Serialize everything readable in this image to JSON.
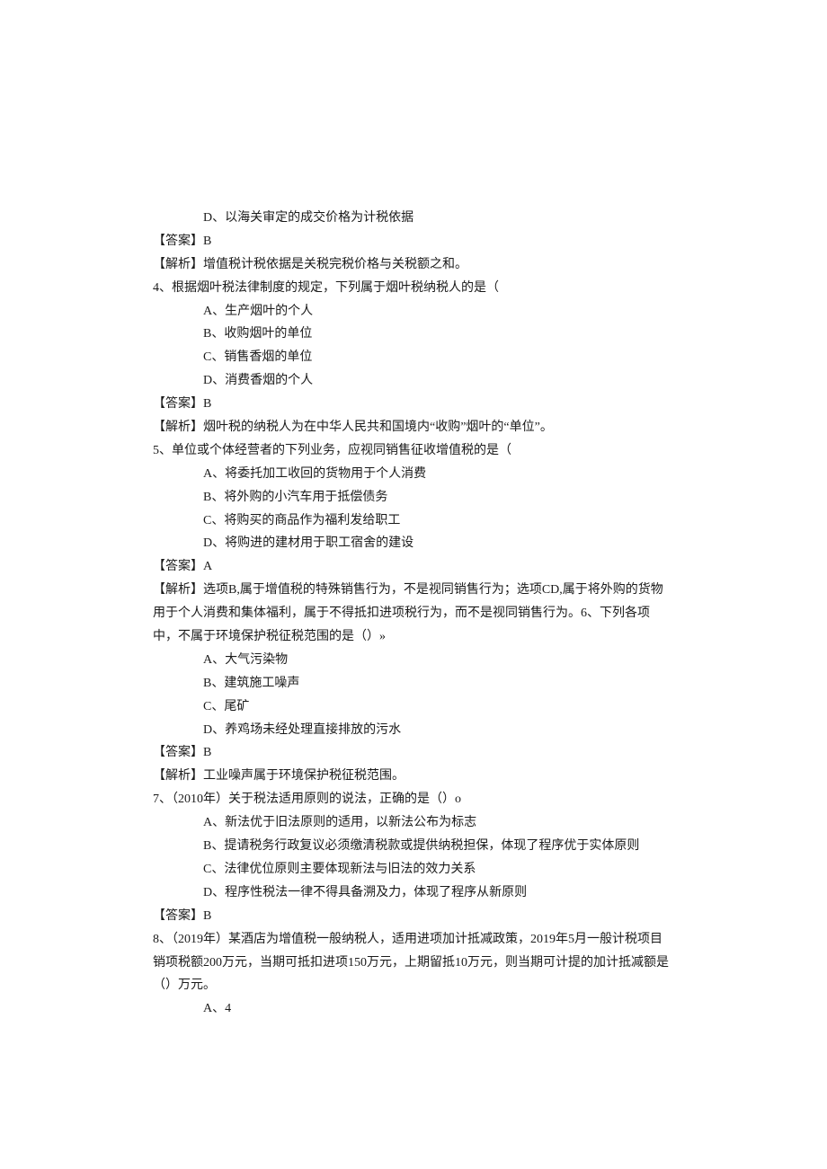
{
  "lines": [
    {
      "cls": "indent2",
      "text": "D、以海关审定的成交价格为计税依据"
    },
    {
      "cls": "",
      "text": "【答案】B"
    },
    {
      "cls": "",
      "text": "【解析】增值税计税依据是关税完税价格与关税额之和。"
    },
    {
      "cls": "",
      "text": "4、根据烟叶税法律制度的规定，下列属于烟叶税纳税人的是（"
    },
    {
      "cls": "indent2",
      "text": "A、生产烟叶的个人"
    },
    {
      "cls": "indent2",
      "text": "B、收购烟叶的单位"
    },
    {
      "cls": "indent2",
      "text": "C、销售香烟的单位"
    },
    {
      "cls": "indent2",
      "text": "D、消费香烟的个人"
    },
    {
      "cls": "",
      "text": "【答案】B"
    },
    {
      "cls": "",
      "text": "【解析】烟叶税的纳税人为在中华人民共和国境内“收购”烟叶的“单位”。"
    },
    {
      "cls": "",
      "text": "5、单位或个体经营者的下列业务，应视同销售征收增值税的是（"
    },
    {
      "cls": "indent2",
      "text": "A、将委托加工收回的货物用于个人消费"
    },
    {
      "cls": "indent2",
      "text": "B、将外购的小汽车用于抵偿债务"
    },
    {
      "cls": "indent2",
      "text": "C、将购买的商品作为福利发给职工"
    },
    {
      "cls": "indent2",
      "text": "D、将购进的建材用于职工宿舍的建设"
    },
    {
      "cls": "",
      "text": "【答案】A"
    },
    {
      "cls": "",
      "text": "【解析】选项B,属于增值税的特殊销售行为，不是视同销售行为；选项CD,属于将外购的货物用于个人消费和集体福利，属于不得抵扣进项税行为，而不是视同销售行为。6、下列各项中，不属于环境保护税征税范围的是（）»"
    },
    {
      "cls": "indent2",
      "text": "A、大气污染物"
    },
    {
      "cls": "indent2",
      "text": "B、建筑施工噪声"
    },
    {
      "cls": "indent2",
      "text": "C、尾矿"
    },
    {
      "cls": "indent2",
      "text": "D、养鸡场未经处理直接排放的污水"
    },
    {
      "cls": "",
      "text": "【答案】B"
    },
    {
      "cls": "",
      "text": "【解析】工业噪声属于环境保护税征税范围。"
    },
    {
      "cls": "",
      "text": "7、（2010年）关于税法适用原则的说法，正确的是（）o"
    },
    {
      "cls": "indent2",
      "text": "A、新法优于旧法原则的适用，以新法公布为标志"
    },
    {
      "cls": "indent2",
      "text": "B、提请税务行政复议必须缴清税款或提供纳税担保，体现了程序优于实体原则"
    },
    {
      "cls": "indent2",
      "text": "C、法律优位原则主要体现新法与旧法的效力关系"
    },
    {
      "cls": "indent2",
      "text": "D、程序性税法一律不得具备溯及力，体现了程序从新原则"
    },
    {
      "cls": "",
      "text": "【答案】B"
    },
    {
      "cls": "",
      "text": "8、（2019年）某酒店为增值税一般纳税人，适用进项加计抵减政策，2019年5月一般计税项目销项税额200万元，当期可抵扣进项150万元，上期留抵10万元，则当期可计提的加计抵减额是（）万元。"
    },
    {
      "cls": "indent2",
      "text": "A、4"
    }
  ]
}
